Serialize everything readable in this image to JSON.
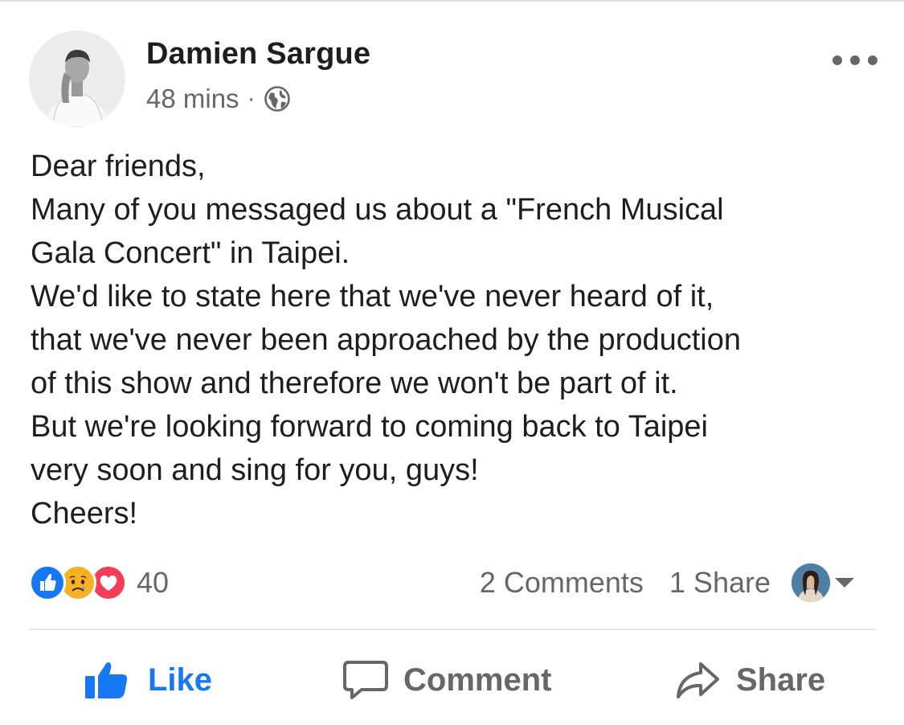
{
  "post": {
    "author": "Damien Sargue",
    "timestamp": "48 mins",
    "separator": "·",
    "privacy_icon": "globe-icon",
    "text_lines": [
      "Dear friends,",
      "Many of you messaged us about a \"French Musical",
      "Gala Concert\" in Taipei.",
      "We'd like to state here that we've never heard of it,",
      "that we've never been approached by the production",
      "of this show and therefore we won't be part of it.",
      "But we're looking forward to coming back to Taipei",
      "very soon and sing for you, guys!",
      "Cheers!"
    ]
  },
  "reactions": {
    "icons": [
      "like-reaction-icon",
      "sad-reaction-icon",
      "love-reaction-icon"
    ],
    "count": "40"
  },
  "stats": {
    "comments": "2 Comments",
    "shares": "1 Share"
  },
  "actions": {
    "like": "Like",
    "comment": "Comment",
    "share": "Share"
  },
  "colors": {
    "accent": "#1877f2",
    "text": "#1c1e21",
    "secondary": "#65676b",
    "divider": "#e4e6eb"
  }
}
